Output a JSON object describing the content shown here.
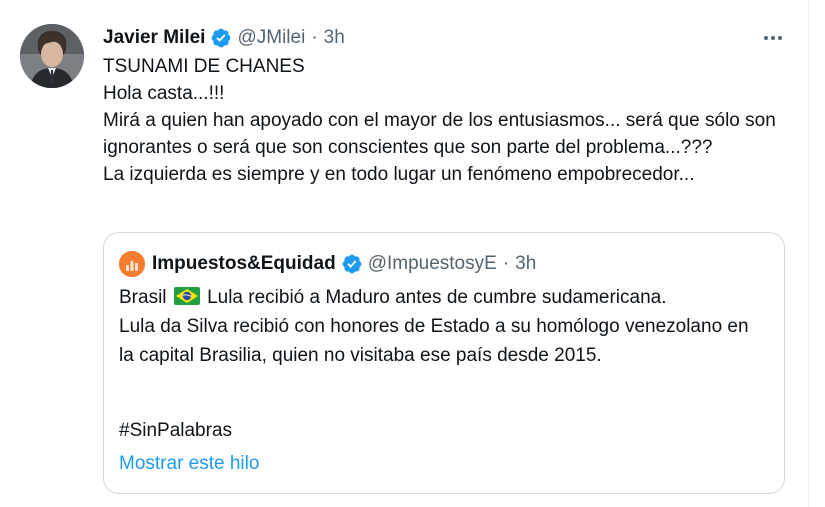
{
  "tweet": {
    "author_name": "Javier Milei",
    "handle": "@JMilei",
    "separator": "·",
    "time": "3h",
    "text_lines": [
      "TSUNAMI DE CHANES",
      "Hola casta...!!!",
      "Mirá a quien han apoyado con el mayor de los entusiasmos... será que sólo son ignorantes o será que son conscientes que son parte del problema...???",
      "La izquierda es siempre y en todo lugar un fenómeno empobrecedor..."
    ],
    "more_icon": "more-horizontal-icon",
    "verified_icon": "verified-badge-icon",
    "verified_color": "#1d9bf0"
  },
  "quote": {
    "author_name": "Impuestos&Equidad",
    "handle": "@ImpuestosyE",
    "separator": "·",
    "time": "3h",
    "text_before_flag": "Brasil",
    "flag_icon": "brazil-flag-icon",
    "text_after_flag": "Lula recibió a Maduro antes de cumbre sudamericana.",
    "text_line2": "Lula da Silva recibió con honores de Estado a su homólogo venezolano en la capital Brasilia, quien no visitaba ese país desde 2015.",
    "hashtag": "#SinPalabras",
    "show_thread": "Mostrar este hilo",
    "avatar_color": "#f47c2c"
  },
  "colors": {
    "text": "#0f1419",
    "secondary": "#536471",
    "link": "#1d9bf0",
    "border": "#cfd9de"
  }
}
